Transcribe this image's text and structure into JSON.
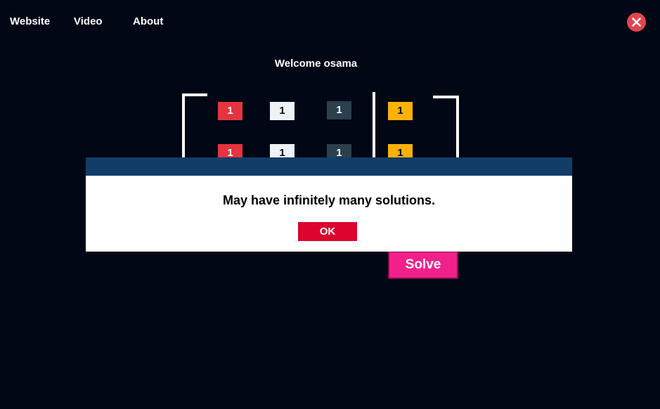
{
  "nav": {
    "items": [
      {
        "label": "Website"
      },
      {
        "label": "Video"
      },
      {
        "label": "About"
      }
    ]
  },
  "close_button": {
    "icon": "close-icon",
    "color": "#e0464e"
  },
  "welcome": {
    "text": "Welcome osama"
  },
  "matrix": {
    "rows": [
      {
        "a": "1",
        "b": "1",
        "c": "1",
        "result": "1"
      },
      {
        "a": "1",
        "b": "1",
        "c": "1",
        "result": "1"
      }
    ],
    "colors": {
      "col_a": "#e5343f",
      "col_b": "#eef2f6",
      "col_c": "#2b3f4d",
      "col_result": "#fbb205"
    }
  },
  "solve_button": {
    "label": "Solve",
    "color": "#f1218b"
  },
  "dialog": {
    "message": "May have infinitely many solutions.",
    "ok_label": "OK",
    "header_color": "#113d68",
    "ok_color": "#dc0530"
  }
}
